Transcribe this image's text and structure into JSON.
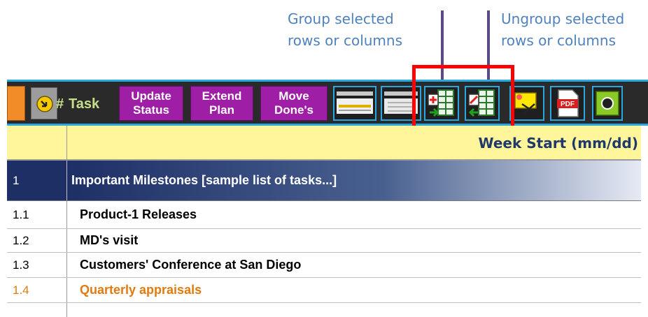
{
  "callouts": {
    "group": "Group selected\nrows or columns",
    "ungroup": "Ungroup selected\nrows or columns"
  },
  "toolbar": {
    "hash_label": "#",
    "task_label": "Task",
    "buttons": [
      {
        "label": "Update\nStatus"
      },
      {
        "label": "Extend\nPlan"
      },
      {
        "label": "Move\nDone's"
      }
    ],
    "pdf_label": "PDF"
  },
  "sheet": {
    "week_start_header": "Week Start (mm/dd)",
    "rows": [
      {
        "id": "1",
        "task": "Important Milestones [sample list of tasks...]"
      },
      {
        "id": "1.1",
        "task": "Product-1 Releases"
      },
      {
        "id": "1.2",
        "task": "MD's visit"
      },
      {
        "id": "1.3",
        "task": "Customers' Conference at San Diego"
      },
      {
        "id": "1.4",
        "task": "Quarterly appraisals"
      },
      {
        "id": "",
        "task": ""
      }
    ]
  },
  "colors": {
    "callout_text": "#4f81bd",
    "toolbar_bg": "#2a2a2a",
    "toolbar_border": "#29a8e0",
    "macro_button": "#9e1fa6",
    "task_label": "#c6e08a",
    "week_header_bg": "#fff59a",
    "milestone_bar_start": "#1e2f66",
    "milestone_bar_end": "#e6eaf4",
    "highlight_box": "#ff0000",
    "appraisal_text": "#e07b10"
  }
}
